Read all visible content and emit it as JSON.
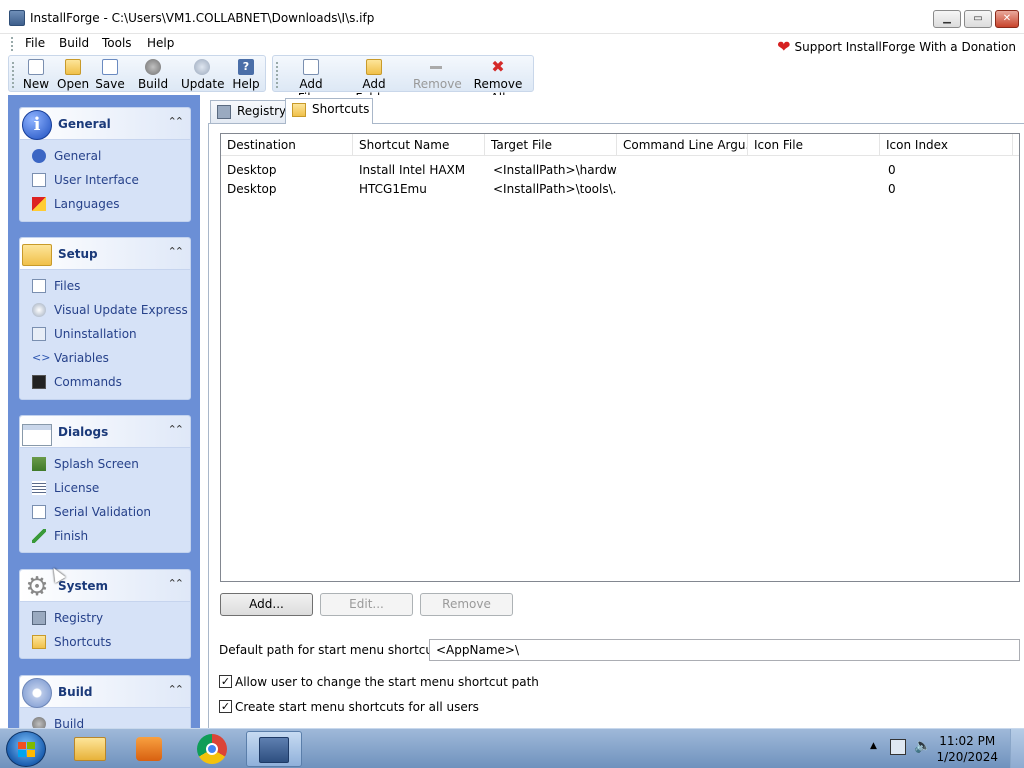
{
  "window": {
    "title": "InstallForge - C:\\Users\\VM1.COLLABNET\\Downloads\\I\\s.ifp",
    "minimize": "▁",
    "maximize": "▭",
    "close": "✕"
  },
  "menu": {
    "items": [
      "File",
      "Build",
      "Tools",
      "Help"
    ],
    "support": "Support InstallForge With a Donation"
  },
  "toolbar": {
    "new": "New",
    "open": "Open",
    "save": "Save",
    "build": "Build",
    "update": "Update",
    "help": "Help",
    "add_files": "Add Files",
    "add_folder": "Add Folder",
    "remove": "Remove",
    "remove_all": "Remove All"
  },
  "sidebar": {
    "general": {
      "title": "General",
      "items": [
        "General",
        "User Interface",
        "Languages"
      ]
    },
    "setup": {
      "title": "Setup",
      "items": [
        "Files",
        "Visual Update Express",
        "Uninstallation",
        "Variables",
        "Commands"
      ]
    },
    "dialogs": {
      "title": "Dialogs",
      "items": [
        "Splash Screen",
        "License",
        "Serial Validation",
        "Finish"
      ]
    },
    "system": {
      "title": "System",
      "items": [
        "Registry",
        "Shortcuts"
      ]
    },
    "build": {
      "title": "Build",
      "items": [
        "Build"
      ]
    }
  },
  "tabs": {
    "registry": "Registry",
    "shortcuts": "Shortcuts"
  },
  "table": {
    "columns": [
      "Destination",
      "Shortcut Name",
      "Target File",
      "Command Line Argu...",
      "Icon File",
      "Icon Index"
    ],
    "rows": [
      [
        "Desktop",
        "Install Intel HAXM",
        "<InstallPath>\\hardw...",
        "",
        "",
        "0"
      ],
      [
        "Desktop",
        "HTCG1Emu",
        "<InstallPath>\\tools\\...",
        "",
        "",
        "0"
      ]
    ]
  },
  "buttons": {
    "add": "Add...",
    "edit": "Edit...",
    "remove": "Remove"
  },
  "start_menu": {
    "label": "Default path for start menu shortcuts:",
    "value": "<AppName>\\",
    "check1": "Allow user to change the start menu shortcut path",
    "check2": "Create start menu shortcuts for all users",
    "check1_checked": true,
    "check2_checked": true
  },
  "taskbar": {
    "time": "11:02 PM",
    "date": "1/20/2024"
  },
  "colors": {
    "sidebar_bg": "#6b8fd6",
    "panel_bg": "#d6e2f7",
    "heart": "#d62020",
    "remove_all_x": "#d42a2a"
  }
}
